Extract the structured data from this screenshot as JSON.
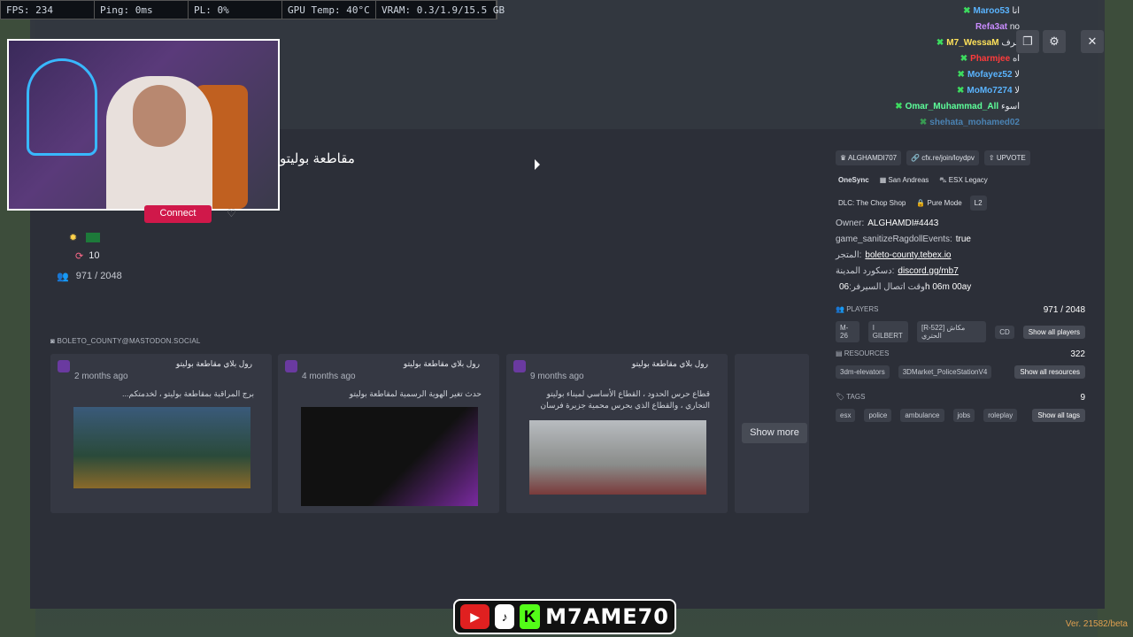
{
  "perf": {
    "fps": "FPS: 234",
    "ping": "Ping: 0ms",
    "pl": "PL: 0%",
    "gpu": "GPU Temp: 40°C",
    "vram": "VRAM: 0.3/1.9/15.5 GB"
  },
  "chat": [
    {
      "name": "Maroo53",
      "msg": "انا",
      "color": "#5ab4ff"
    },
    {
      "name": "Refa3at",
      "msg": "no",
      "color": "#c98cff"
    },
    {
      "name": "M7_WessaM",
      "msg": "قرف",
      "color": "#ffe25a"
    },
    {
      "name": "Pharmjee",
      "msg": "اه",
      "color": "#ff3b3b"
    },
    {
      "name": "Mofayez52",
      "msg": "لا",
      "color": "#5ab4ff"
    },
    {
      "name": "MoMo7274",
      "msg": "لا",
      "color": "#5ab4ff"
    },
    {
      "name": "Omar_Muhammad_All",
      "msg": "اسوء",
      "color": "#5dff9a"
    },
    {
      "name": "shehata_mohamed02",
      "msg": "",
      "color": "#5ab4ff"
    }
  ],
  "server": {
    "title": "مقاطعة بوليتو",
    "connect": "Connect",
    "boosts": "10",
    "players": "971 / 2048"
  },
  "social": {
    "label": "BOLETO_COUNTY@MASTODON.SOCIAL",
    "show_more": "Show more"
  },
  "posts": [
    {
      "title": "رول بلاي مقاطعة بوليتو",
      "time": "2 months ago",
      "text": "برج المراقبة بمقاطعة بوليتو ، لخدمتكم..."
    },
    {
      "title": "رول بلاي مقاطعة بوليتو",
      "time": "4 months ago",
      "text": "حدث تغير الهوية الرسمية لمقاطعة بوليتو"
    },
    {
      "title": "رول بلاي مقاطعة بوليتو",
      "time": "9 months ago",
      "text": "قطاع حرس الحدود ، القطاع الأساسي لميناء بوليتو التجاري ، والقطاع الذي يحرس محمية جزيرة فرسان"
    }
  ],
  "right": {
    "chips1": [
      "ALGHAMDI707",
      "cfx.re/join/loydpv",
      "UPVOTE"
    ],
    "chips2": [
      "OneSync",
      "San Andreas",
      "ESX Legacy"
    ],
    "chips3": [
      "DLC: The Chop Shop",
      "Pure Mode",
      "L2"
    ],
    "owner_label": "Owner:",
    "owner": "ALGHAMDI#4443",
    "ragdoll_label": "game_sanitizeRagdollEvents:",
    "ragdoll": "true",
    "store_label": "المتجر:",
    "store": "boleto-county.tebex.io",
    "discord_label": "دسكورد المدينة:",
    "discord": "discord.gg/mb7",
    "uptime_label": "وقت اتصال السيرفر:",
    "uptime": "06h 06m 00ay"
  },
  "players_sec": {
    "label": "PLAYERS",
    "count": "971 / 2048",
    "items": [
      "M-26",
      "I GILBERT",
      "[R-522] مكاش الحتري",
      "CD"
    ],
    "btn": "Show all players"
  },
  "resources_sec": {
    "label": "RESOURCES",
    "count": "322",
    "items": [
      "3dm-elevators",
      "3DMarket_PoliceStationV4"
    ],
    "btn": "Show all resources"
  },
  "tags_sec": {
    "label": "TAGS",
    "count": "9",
    "items": [
      "esx",
      "police",
      "ambulance",
      "jobs",
      "roleplay"
    ],
    "btn": "Show all tags"
  },
  "brand": {
    "text": "M7AME70",
    "yt": "▶",
    "tt": "♪",
    "k": "K"
  },
  "version": "Ver. 21582/beta"
}
